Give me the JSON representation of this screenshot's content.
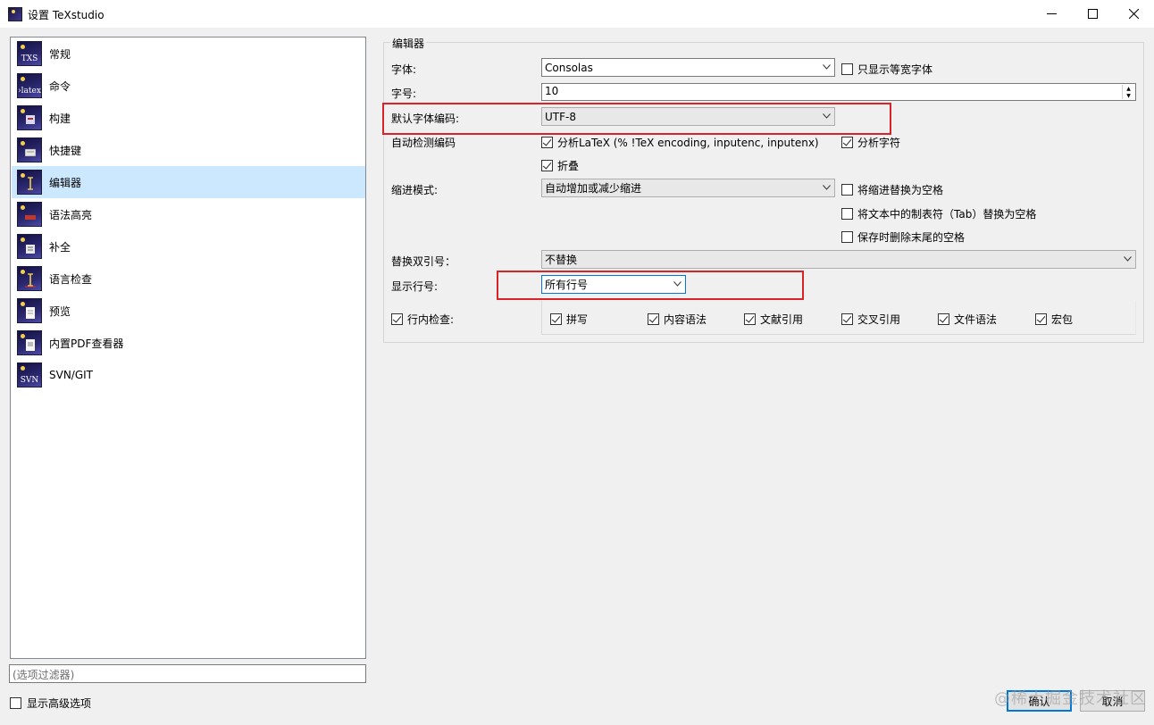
{
  "window": {
    "title": "设置 TeXstudio",
    "minimize_icon": "minimize-icon",
    "maximize_icon": "maximize-icon",
    "close_icon": "close-icon"
  },
  "sidebar": {
    "items": [
      {
        "label": "常规",
        "icon": "txs-icon",
        "icon_text": "TXS",
        "selected": false
      },
      {
        "label": "命令",
        "icon": "latex-icon",
        "icon_text": "›latex",
        "selected": false
      },
      {
        "label": "构建",
        "icon": "build-icon",
        "icon_text": "",
        "selected": false
      },
      {
        "label": "快捷键",
        "icon": "keyboard-icon",
        "icon_text": "",
        "selected": false
      },
      {
        "label": "编辑器",
        "icon": "editor-icon",
        "icon_text": "",
        "selected": true
      },
      {
        "label": "语法高亮",
        "icon": "syntax-highlight-icon",
        "icon_text": "",
        "selected": false
      },
      {
        "label": "补全",
        "icon": "completion-icon",
        "icon_text": "",
        "selected": false
      },
      {
        "label": "语言检查",
        "icon": "language-check-icon",
        "icon_text": "",
        "selected": false
      },
      {
        "label": "预览",
        "icon": "preview-icon",
        "icon_text": "",
        "selected": false
      },
      {
        "label": "内置PDF查看器",
        "icon": "pdf-viewer-icon",
        "icon_text": "",
        "selected": false
      },
      {
        "label": "SVN/GIT",
        "icon": "svn-icon",
        "icon_text": "SVN",
        "selected": false
      }
    ],
    "filter_placeholder": "(选项过滤器)",
    "advanced_label": "显示高级选项",
    "advanced_checked": false
  },
  "editor": {
    "group_title": "编辑器",
    "font_label": "字体:",
    "font_value": "Consolas",
    "monospace_only_label": "只显示等宽字体",
    "monospace_only_checked": false,
    "size_label": "字号:",
    "size_value": "10",
    "encoding_label": "默认字体编码:",
    "encoding_value": "UTF-8",
    "autodetect_label": "自动检测编码",
    "parse_latex_label": "分析LaTeX (% !TeX encoding, inputenc, inputenx)",
    "parse_latex_checked": true,
    "parse_chars_label": "分析字符",
    "parse_chars_checked": true,
    "fold_label": "折叠",
    "fold_checked": true,
    "indent_label": "缩进模式:",
    "indent_value": "自动增加或减少缩进",
    "replace_indent_label": "将缩进替换为空格",
    "replace_indent_checked": false,
    "replace_tabs_label": "将文本中的制表符（Tab）替换为空格",
    "replace_tabs_checked": false,
    "remove_trailing_label": "保存时删除末尾的空格",
    "remove_trailing_checked": false,
    "quotes_label": "替换双引号：",
    "quotes_value": "不替换",
    "line_numbers_label": "显示行号:",
    "line_numbers_value": "所有行号",
    "inline_check_label": "行内检查:",
    "inline_check_checked": true,
    "inline_options": [
      {
        "label": "拼写",
        "checked": true
      },
      {
        "label": "内容语法",
        "checked": true
      },
      {
        "label": "文献引用",
        "checked": true
      },
      {
        "label": "交叉引用",
        "checked": true
      },
      {
        "label": "文件语法",
        "checked": true
      },
      {
        "label": "宏包",
        "checked": true
      }
    ]
  },
  "buttons": {
    "ok_label": "确认",
    "cancel_label": "取消"
  },
  "watermark": "@稀土掘金技术社区",
  "colors": {
    "selection": "#cce8ff",
    "highlight_box": "#d9232b",
    "focus": "#0078d7"
  }
}
